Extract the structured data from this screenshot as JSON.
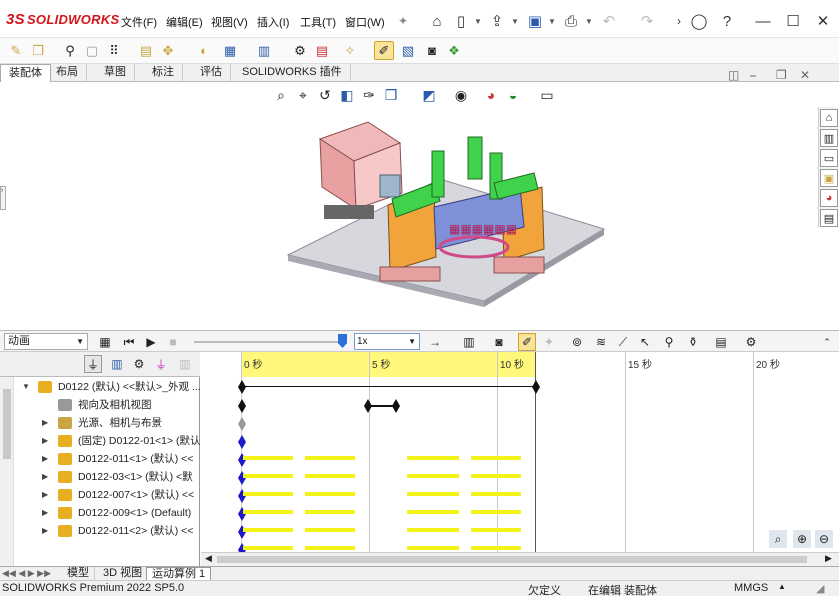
{
  "app": {
    "logo_text": "SOLIDWORKS",
    "logo_mark": "3S"
  },
  "menu": [
    "文件(F)",
    "编辑(E)",
    "视图(V)",
    "插入(I)",
    "工具(T)",
    "窗口(W)"
  ],
  "cm_tabs": [
    "装配体",
    "布局",
    "草图",
    "标注",
    "评估",
    "SOLIDWORKS 插件"
  ],
  "motion": {
    "study_type": "动画",
    "speed": "1x",
    "timeline_ticks": [
      "0 秒",
      "5 秒",
      "10 秒",
      "15 秒",
      "20 秒"
    ]
  },
  "tree": {
    "rows": [
      {
        "label": "D0122 (默认) <<默认>_外观 ...",
        "icon": "assembly-icon",
        "color": "#e8b020"
      },
      {
        "label": "视向及相机视图",
        "icon": "camera-icon",
        "color": "#888888"
      },
      {
        "label": "光源、相机与布景",
        "icon": "light-icon",
        "color": "#c9a642"
      },
      {
        "label": "(固定) D0122-01<1> (默认",
        "icon": "part-icon",
        "color": "#e8b020"
      },
      {
        "label": "D0122-011<1> (默认) <<",
        "icon": "part-icon",
        "color": "#e8b020"
      },
      {
        "label": "D0122-03<1> (默认) <默",
        "icon": "part-icon",
        "color": "#e8b020"
      },
      {
        "label": "D0122-007<1> (默认) <<",
        "icon": "part-icon",
        "color": "#e8b020"
      },
      {
        "label": "D0122-009<1> (Default)",
        "icon": "part-icon",
        "color": "#e8b020"
      },
      {
        "label": "D0122-011<2> (默认) <<",
        "icon": "part-icon",
        "color": "#e8b020"
      }
    ]
  },
  "bottom_tabs": [
    "模型",
    "3D 视图",
    "运动算例 1"
  ],
  "status": {
    "version": "SOLIDWORKS Premium 2022 SP5.0",
    "state1": "欠定义",
    "state2": "在编辑 装配体",
    "units": "MMGS"
  },
  "colors": {
    "accent": "#d3141b",
    "timeline_header": "#fff87a",
    "keyframe": "#1a1acc",
    "change_bar": "#f3f31a"
  }
}
